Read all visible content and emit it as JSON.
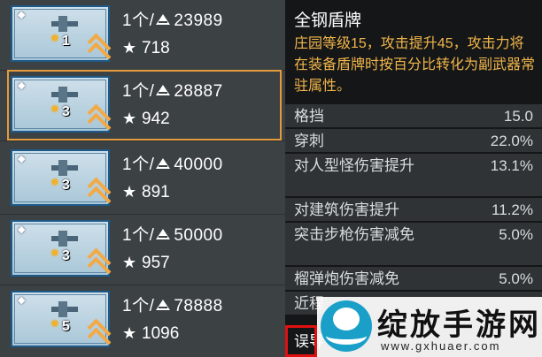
{
  "list": {
    "items": [
      {
        "level": "1",
        "price_prefix": "1个/",
        "price": "23989",
        "stat": "718",
        "selected": false
      },
      {
        "level": "3",
        "price_prefix": "1个/",
        "price": "28887",
        "stat": "942",
        "selected": true
      },
      {
        "level": "3",
        "price_prefix": "1个/",
        "price": "40000",
        "stat": "891",
        "selected": false
      },
      {
        "level": "3",
        "price_prefix": "1个/",
        "price": "50000",
        "stat": "957",
        "selected": false
      },
      {
        "level": "5",
        "price_prefix": "1个/",
        "price": "78888",
        "stat": "1096",
        "selected": false
      }
    ]
  },
  "panel": {
    "title": "全钢盾牌",
    "desc": "庄园等级15，攻击提升45，攻击力将在装备盾牌时按百分比转化为副武器常驻属性。",
    "attrs": [
      {
        "name": "格挡",
        "value": "15.0"
      },
      {
        "name": "穿刺",
        "value": "22.0%"
      },
      {
        "name": "对人型怪伤害提升",
        "value": "13.1%"
      },
      {
        "name": "对建筑伤害提升",
        "value": "11.2%"
      },
      {
        "name": "突击步枪伤害减免",
        "value": "5.0%"
      },
      {
        "name": "榴弹炮伤害减免",
        "value": "5.0%"
      },
      {
        "name": "近程",
        "value": ""
      }
    ],
    "bottom_text": "误导"
  },
  "watermark": {
    "title": "绽放手游网",
    "url": "www.gxhuaer.com"
  },
  "colors": {
    "accent": "#e59a3c",
    "desc": "#f2b64a",
    "card_border": "#1d5a8a",
    "highlight": "#e01010"
  }
}
